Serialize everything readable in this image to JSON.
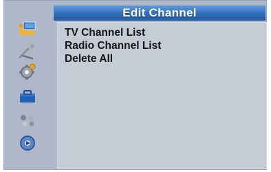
{
  "window": {
    "title": "Edit Channel"
  },
  "sidebar": {
    "items": [
      {
        "icon": "channel-folder-icon"
      },
      {
        "icon": "tools-icon"
      },
      {
        "icon": "settings-gear-icon"
      },
      {
        "icon": "toolbox-icon"
      },
      {
        "icon": "games-icon"
      },
      {
        "icon": "media-disc-icon"
      }
    ]
  },
  "menu": {
    "items": [
      {
        "label": "TV Channel List"
      },
      {
        "label": "Radio Channel List"
      },
      {
        "label": "Delete All"
      }
    ]
  },
  "colors": {
    "title_bar": "#2f6db9",
    "panel_bg": "#c5ccd6",
    "frame_bg": "#aeb8c8",
    "menu_text": "#141414"
  }
}
